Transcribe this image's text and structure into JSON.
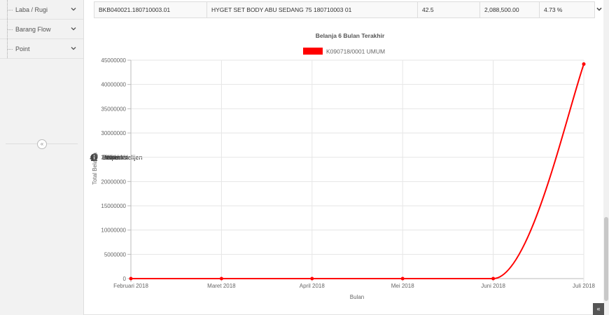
{
  "sidebar": {
    "sub_items": [
      {
        "label": "Laba / Rugi"
      },
      {
        "label": "Barang Flow"
      },
      {
        "label": "Point"
      }
    ],
    "main_items": [
      {
        "label": "Bisnis Intelijen",
        "icon": "user-icon"
      },
      {
        "label": "Helper",
        "icon": "double-chevron-right-icon"
      },
      {
        "label": "Utilitas",
        "icon": "gears-icon"
      },
      {
        "label": "Informasi",
        "icon": "info-circle-icon"
      }
    ],
    "collapse_symbol": "«"
  },
  "detail_row": {
    "code": "BKB040021.180710003.01",
    "item": "HYGET SET BODY ABU SEDANG 75 180710003 01",
    "qty": "42.5",
    "amount": "2,088,500.00",
    "percent": "4.73 %"
  },
  "chart_data": {
    "type": "line",
    "title": "Belanja 6 Bulan Terakhir",
    "xlabel": "Bulan",
    "ylabel": "Total Belanja",
    "categories": [
      "Februari 2018",
      "Maret 2018",
      "April 2018",
      "Mei 2018",
      "Juni 2018",
      "Juli 2018"
    ],
    "series": [
      {
        "name": "K090718/0001 UMUM",
        "values": [
          0,
          0,
          0,
          0,
          0,
          44200000
        ],
        "color": "#ff0000"
      }
    ],
    "ylim": [
      0,
      45000000
    ],
    "yticks": [
      "0",
      "5000000",
      "10000000",
      "15000000",
      "20000000",
      "25000000",
      "30000000",
      "35000000",
      "40000000",
      "45000000"
    ],
    "grid": true,
    "legend": "top"
  },
  "colors": {
    "accent": "#ff0000",
    "sidebar_bg": "#f2f2f2"
  },
  "scroll_top_symbol": "«"
}
